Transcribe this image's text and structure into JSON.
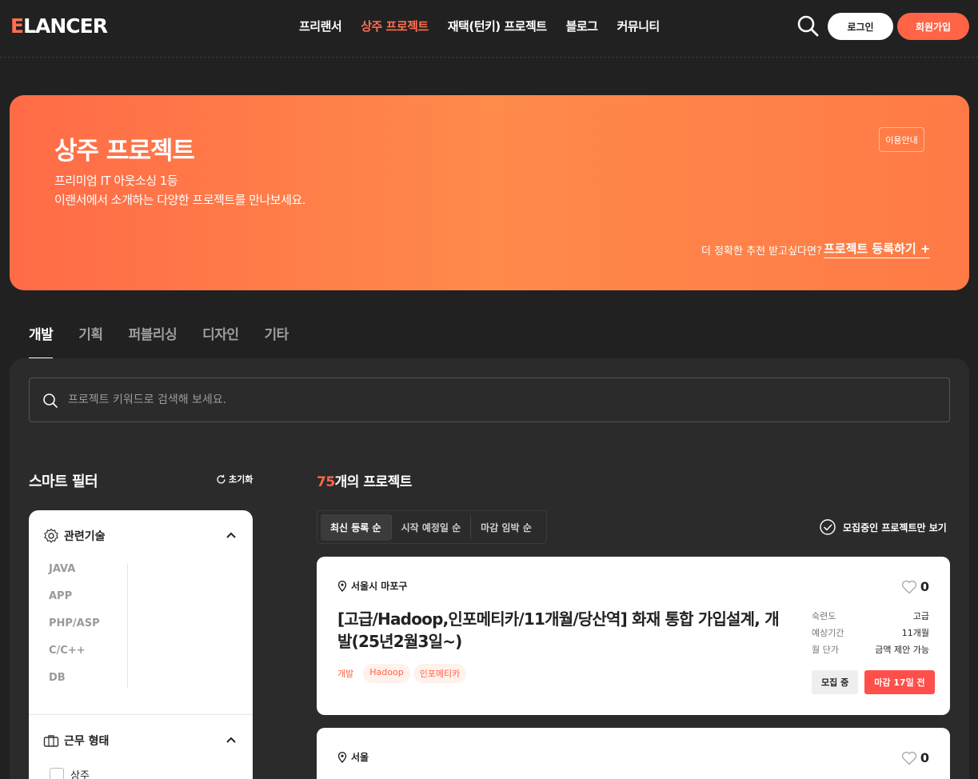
{
  "header": {
    "logo": "ELANCER",
    "nav": [
      "프리랜서",
      "상주 프로젝트",
      "재택(턴키) 프로젝트",
      "블로그",
      "커뮤니티"
    ],
    "active_nav": "상주 프로젝트",
    "login": "로그인",
    "signup": "회원가입"
  },
  "banner": {
    "title": "상주 프로젝트",
    "sub1": "프리미엄 IT 아웃소싱 1등",
    "sub2": "이랜서에서 소개하는 다양한 프로젝트를 만나보세요.",
    "guide": "이용안내",
    "question": "더 정확한 추천 받고싶다면?",
    "register": "프로젝트 등록하기 +"
  },
  "tabs": [
    "개발",
    "기획",
    "퍼블리싱",
    "디자인",
    "기타"
  ],
  "search": {
    "placeholder": "프로젝트 키워드로 검색해 보세요."
  },
  "filter": {
    "title": "스마트 필터",
    "reset": "초기화",
    "skills_title": "관련기술",
    "skills": [
      "JAVA",
      "APP",
      "PHP/ASP",
      "C/C++",
      "DB"
    ],
    "work_title": "근무 형태",
    "work_options": [
      "상주"
    ]
  },
  "results": {
    "count": "75",
    "count_suffix": "개의 프로젝트",
    "sort": [
      "최신 등록 순",
      "시작 예정일 순",
      "마감 임박 순"
    ],
    "recruit_only": "모집중인 프로젝트만 보기"
  },
  "cards": [
    {
      "location": "서울시 마포구",
      "likes": "0",
      "title": "[고급/Hadoop,인포메티카/11개월/당산역] 화재 통합 가입설계, 개발(25년2월3일~)",
      "tags": [
        "개발",
        "Hadoop",
        "인포메티카"
      ],
      "meta": [
        {
          "k": "숙련도",
          "v": "고급"
        },
        {
          "k": "예상기간",
          "v": "11개월"
        },
        {
          "k": "월 단가",
          "v": "금액 제안 가능"
        }
      ],
      "status": "모집 중",
      "deadline": "마감 17일 전"
    },
    {
      "location": "서울",
      "likes": "0"
    }
  ],
  "colors": {
    "accent": "#ff6446",
    "bg": "#212121",
    "panel": "#2b2b2b"
  }
}
